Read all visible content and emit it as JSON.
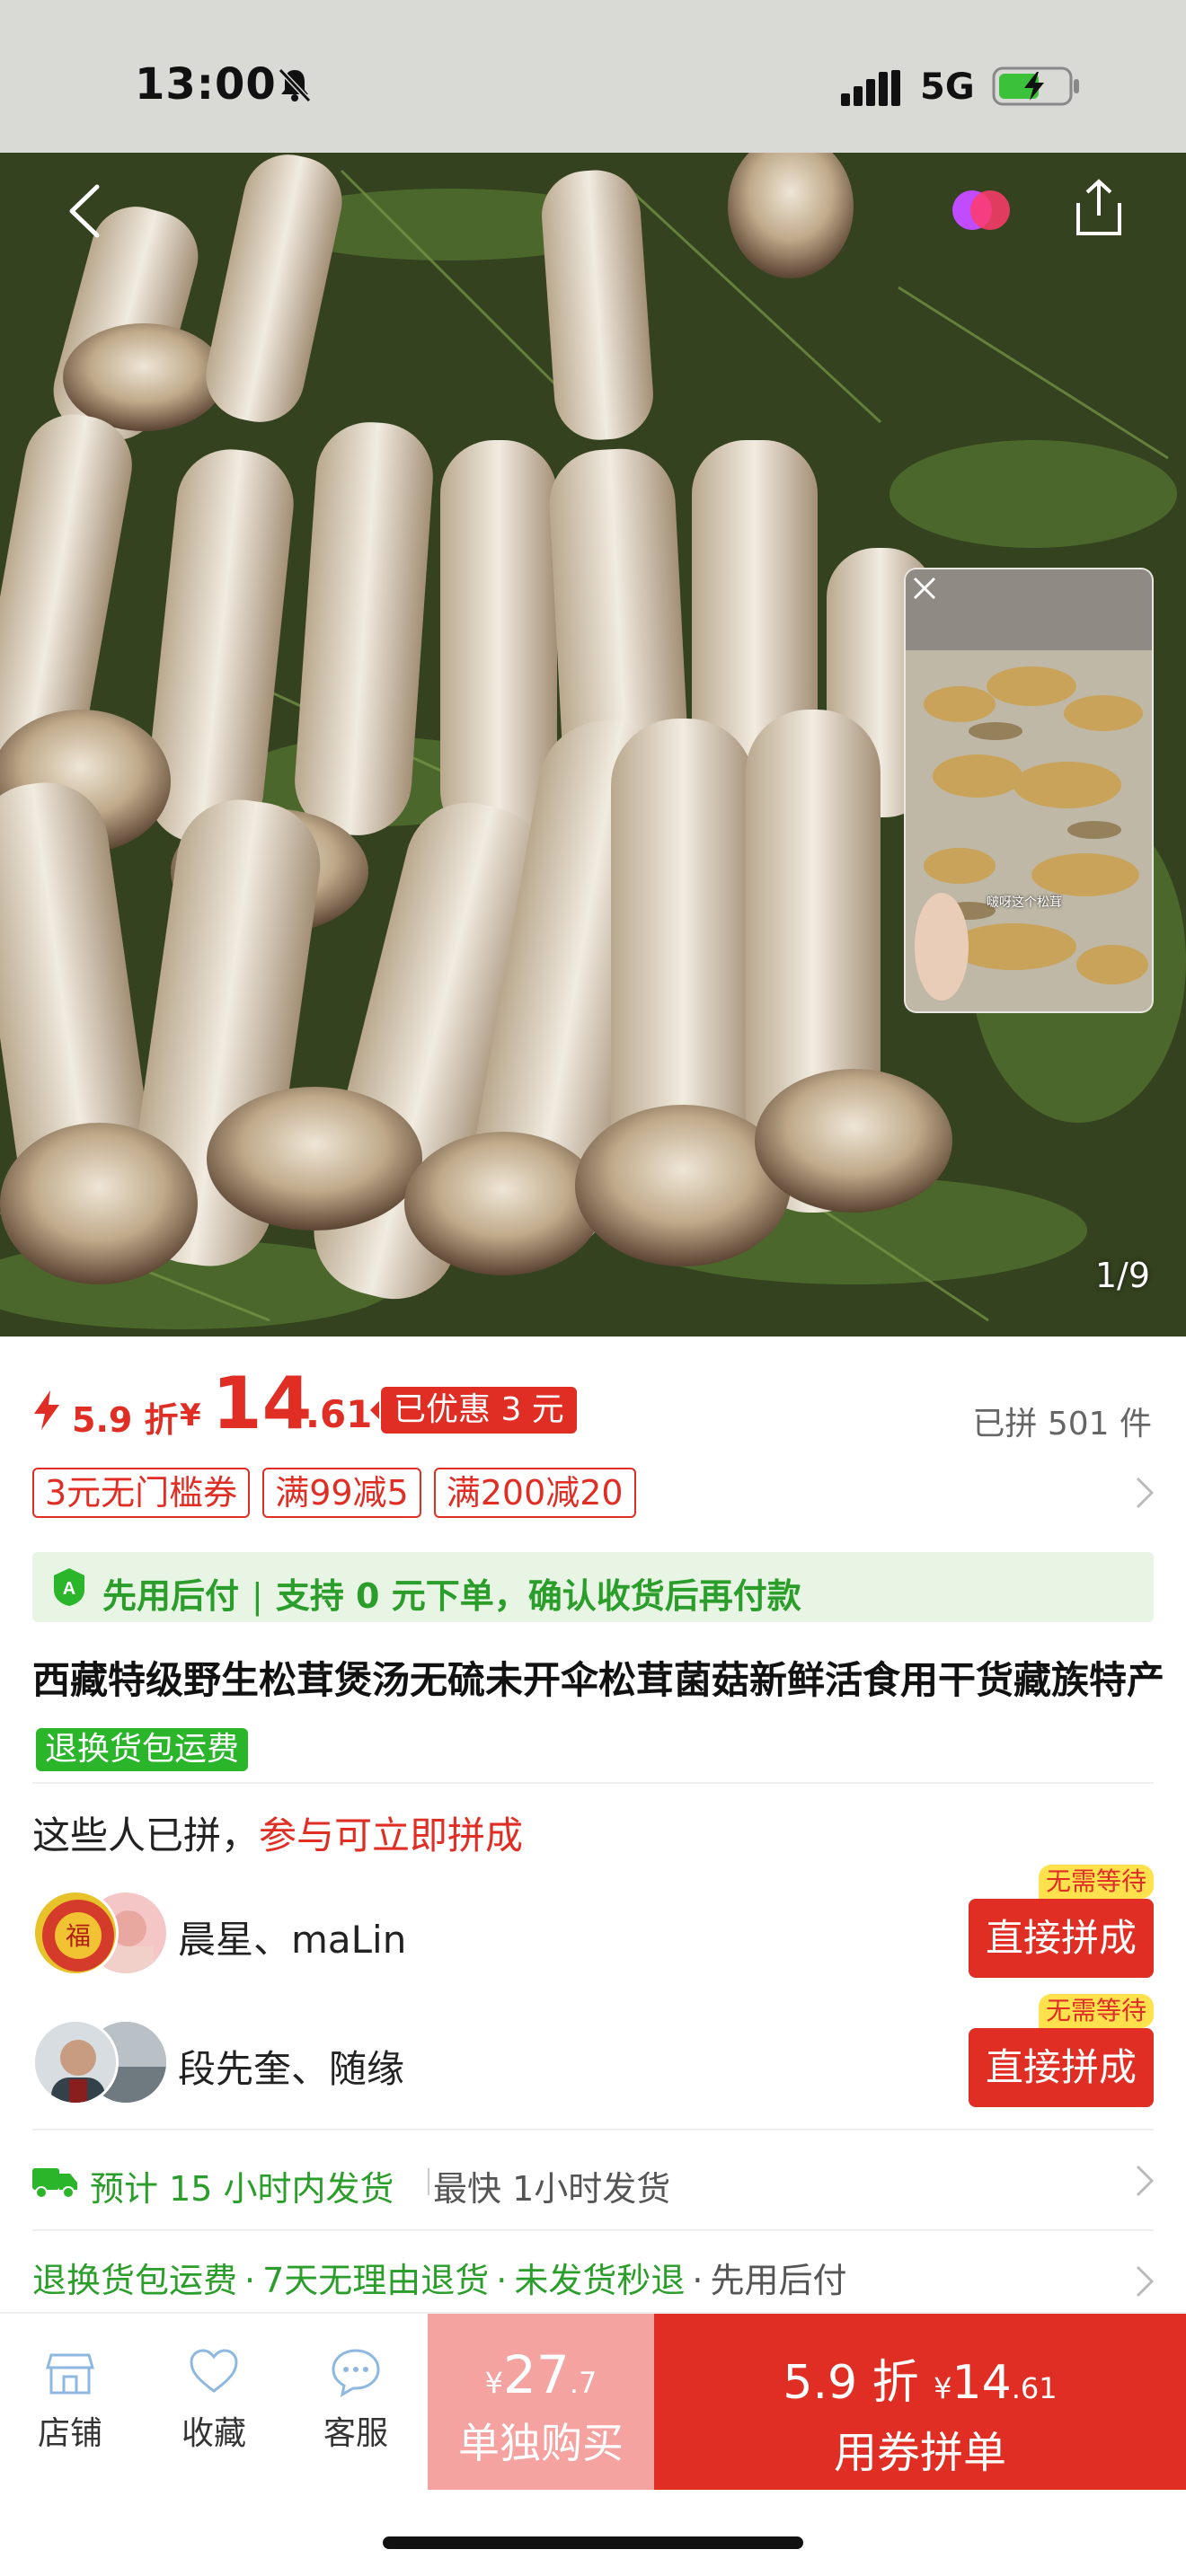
{
  "status_bar": {
    "time": "13:00",
    "network": "5G",
    "icons": [
      "bell-off-icon",
      "signal-icon",
      "battery-charging-icon"
    ]
  },
  "gallery": {
    "page_indicator": "1/9",
    "video_caption": "啵呀这个松茸"
  },
  "price": {
    "discount": "5.9 折",
    "currency": "¥",
    "integer": "14",
    "decimal": ".61",
    "saved": "已优惠 3 元",
    "joined": "已拼 501 件"
  },
  "coupons": [
    "3元无门槛券",
    "满99减5",
    "满200减20"
  ],
  "pay_later": {
    "title": "先用后付",
    "detail": "支持 0 元下单，确认收货后再付款"
  },
  "product": {
    "title": "西藏特级野生松茸煲汤无硫未开伞松茸菌菇新鲜活食用干货藏族特产",
    "tag": "退换货包运费"
  },
  "group_buy": {
    "header_prefix": "这些人已拼，",
    "header_accent": "参与可立即拼成",
    "rows": [
      {
        "names": "晨星、maLin",
        "badge": "无需等待",
        "button": "直接拼成"
      },
      {
        "names": "段先奎、随缘",
        "badge": "无需等待",
        "button": "直接拼成"
      }
    ]
  },
  "shipping": {
    "estimate": "预计 15 小时内发货",
    "fastest": "最快 1小时发货"
  },
  "services": {
    "items": [
      "退换货包运费",
      "7天无理由退货",
      "未发货秒退"
    ],
    "last": "先用后付"
  },
  "bottom_nav": {
    "store": "店铺",
    "favorite": "收藏",
    "service": "客服",
    "solo": {
      "yen": "¥",
      "int": "27",
      "dec": ".7",
      "label": "单独购买"
    },
    "group": {
      "discount": "5.9 折",
      "yen": "¥",
      "int": "14",
      "dec": ".61",
      "label": "用券拼单"
    }
  },
  "colors": {
    "accent_red": "#e02e24",
    "green": "#2a9d2a",
    "solo_pink": "#f4a3a1"
  }
}
